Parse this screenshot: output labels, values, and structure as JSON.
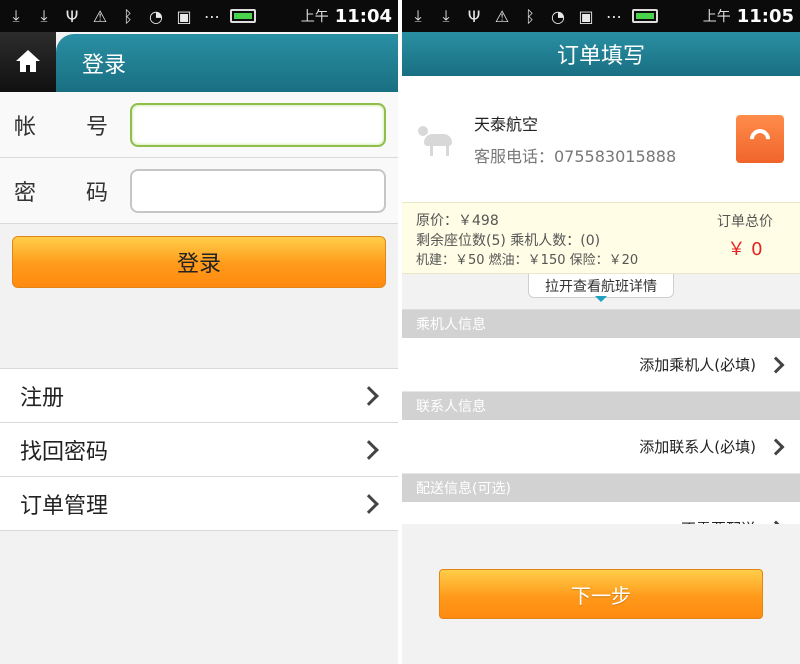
{
  "left": {
    "status": {
      "ampm": "上午",
      "time": "11:04"
    },
    "header": {
      "title": "登录"
    },
    "form": {
      "account_label_1": "帐",
      "account_label_2": "号",
      "password_label_1": "密",
      "password_label_2": "码",
      "account_value": "",
      "password_value": ""
    },
    "login_button": "登录",
    "menu": [
      "注册",
      "找回密码",
      "订单管理"
    ]
  },
  "right": {
    "status": {
      "ampm": "上午",
      "time": "11:05"
    },
    "header": {
      "title": "订单填写"
    },
    "airline": {
      "name": "天泰航空",
      "phone": "客服电话：075583015888"
    },
    "price": {
      "original": "原价：￥498",
      "seats": "剩余座位数(5) 乘机人数：(0)",
      "fees": "机建：￥50 燃油：￥150 保险：￥20",
      "total_label": "订单总价",
      "total_value": "￥ 0"
    },
    "flight_toggle": "拉开查看航班详情",
    "sections": [
      {
        "title": "乘机人信息",
        "action": "添加乘机人(必填)"
      },
      {
        "title": "联系人信息",
        "action": "添加联系人(必填)"
      },
      {
        "title": "配送信息(可选)",
        "action": "不需要配送"
      }
    ],
    "next_button": "下一步"
  }
}
